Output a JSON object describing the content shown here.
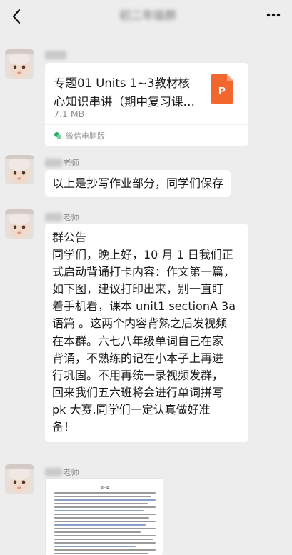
{
  "header": {
    "title": "初二年级群"
  },
  "messages": [
    {
      "type": "file",
      "sender_suffix": "",
      "file_title": "专题01 Units 1~3教材核心知识串讲（期中复习课…",
      "file_size": "7.1 MB",
      "source": "微信电脑版"
    },
    {
      "type": "text",
      "sender_suffix": "老师",
      "text": "以上是抄写作业部分，同学们保存"
    },
    {
      "type": "announcement",
      "sender_suffix": "老师",
      "heading": "群公告",
      "lines": [
        "同学们，晚上好，10 月 1 日我们正",
        "式启动背诵打卡内容：作文第一篇，",
        "如下图，建议打印出来，别一直盯",
        "着手机看，课本 unit1 sectionA  3a",
        "语篇 。这两个内容背熟之后发视频",
        "在本群。六七八年级单词自己在家",
        "背诵，不熟练的记在小本子上再进",
        "行巩固。不用再统一录视频发群，",
        "回来我们五六班将会进行单词拼写",
        "pk 大赛.同学们一定认真做好准",
        "备！"
      ]
    },
    {
      "type": "image",
      "sender_suffix": "老师",
      "image_heading": "第一篇"
    }
  ],
  "colors": {
    "background": "#ededed",
    "bubble": "#ffffff",
    "ppt_orange": "#f2672e",
    "mini_program_green": "#2aae67"
  }
}
